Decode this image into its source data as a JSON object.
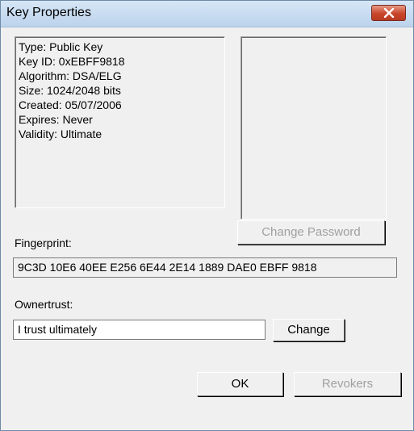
{
  "window": {
    "title": "Key Properties"
  },
  "key_info": {
    "lines": [
      "Type: Public Key",
      "Key ID: 0xEBFF9818",
      "Algorithm: DSA/ELG",
      "Size: 1024/2048 bits",
      "Created: 05/07/2006",
      "Expires: Never",
      "Validity: Ultimate"
    ]
  },
  "buttons": {
    "change_password": "Change Password",
    "change": "Change",
    "ok": "OK",
    "revokers": "Revokers"
  },
  "fingerprint": {
    "label": "Fingerprint:",
    "value": "9C3D 10E6 40EE E256 6E44 2E14 1889 DAE0 EBFF 9818"
  },
  "ownertrust": {
    "label": "Ownertrust:",
    "value": "I trust ultimately"
  },
  "colors": {
    "title_bar": "#bcd3ec",
    "close_button": "#c9452a",
    "dialog_bg": "#f0f0f0",
    "disabled_text": "#a0a0a0"
  },
  "icons": {
    "close": "close-x-icon"
  }
}
